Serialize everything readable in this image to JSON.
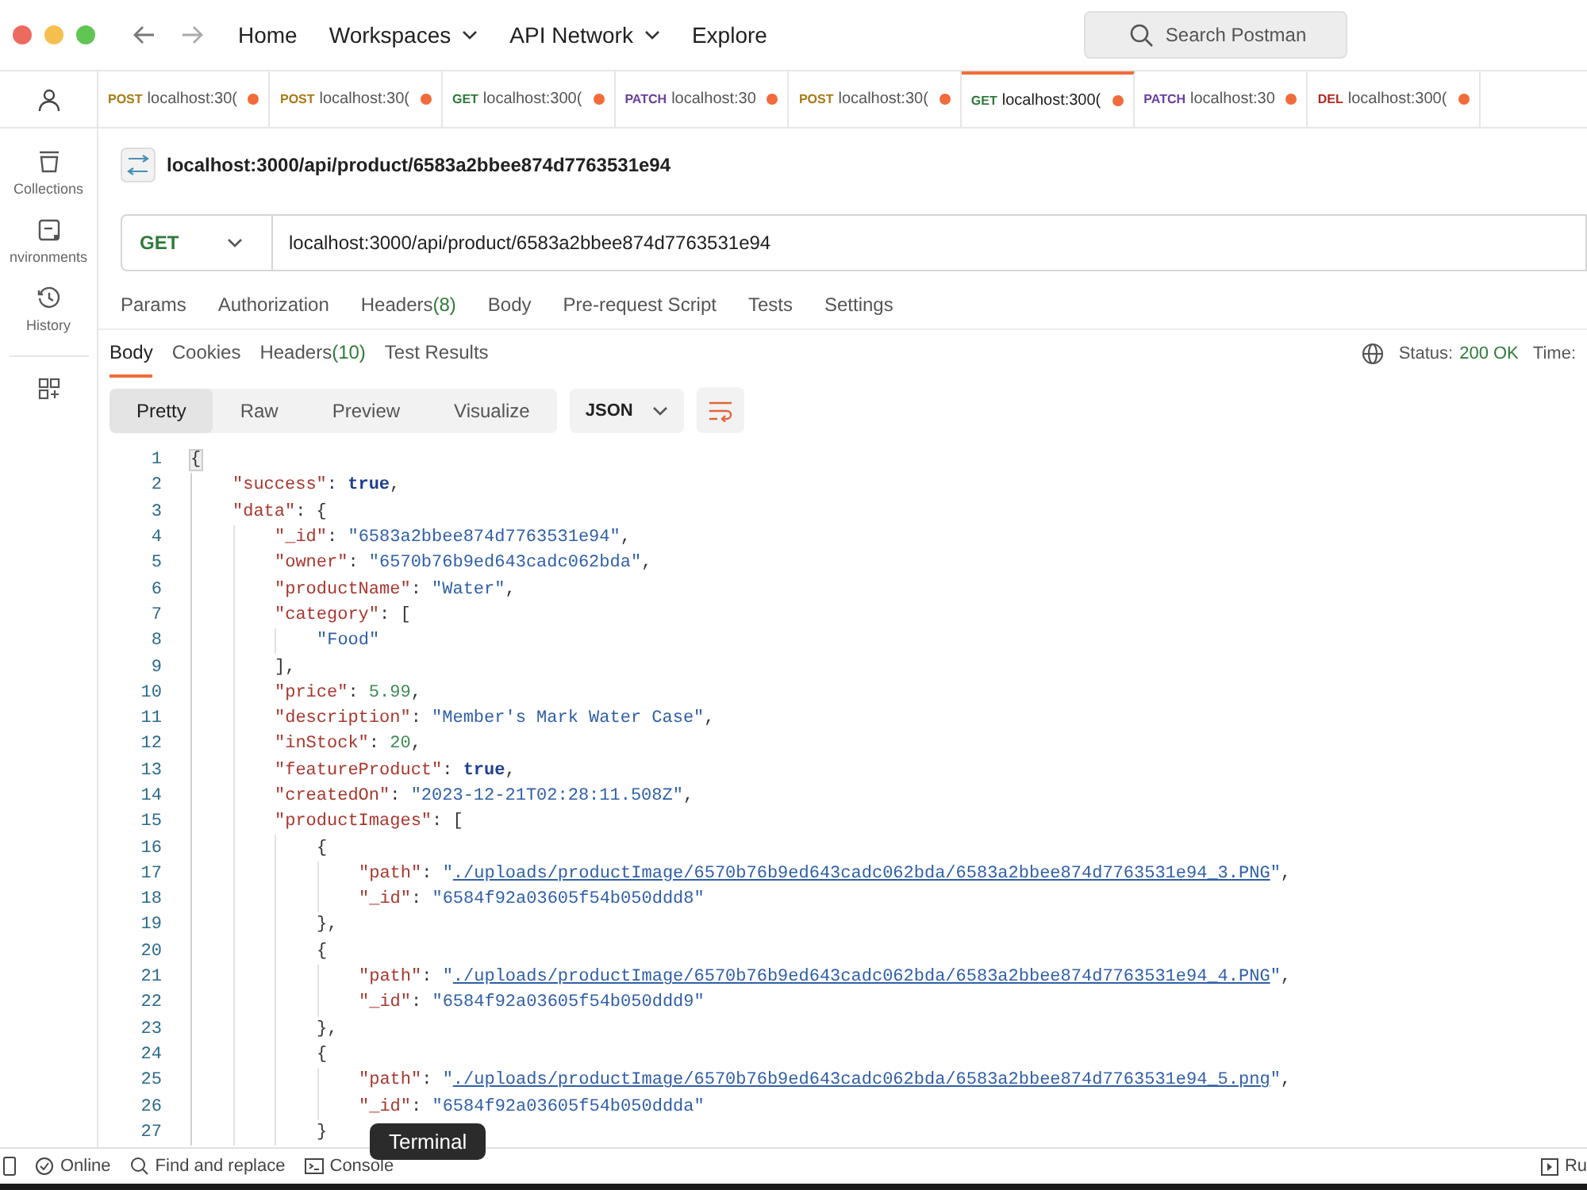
{
  "topbar": {
    "nav": [
      {
        "label": "Home",
        "dropdown": false
      },
      {
        "label": "Workspaces",
        "dropdown": true
      },
      {
        "label": "API Network",
        "dropdown": true
      },
      {
        "label": "Explore",
        "dropdown": false
      }
    ],
    "search": {
      "placeholder": "Search Postman"
    }
  },
  "sidebar": {
    "items": [
      {
        "kind": "user"
      },
      {
        "kind": "collections",
        "label": "Collections"
      },
      {
        "kind": "environments",
        "label": "nvironments"
      },
      {
        "kind": "history",
        "label": "History"
      },
      {
        "kind": "apps"
      }
    ]
  },
  "tabs": [
    {
      "method": "POST",
      "color": "#a87b16",
      "label": "localhost:30(",
      "unsaved": true,
      "selected": false
    },
    {
      "method": "POST",
      "color": "#a87b16",
      "label": "localhost:30(",
      "unsaved": true,
      "selected": false
    },
    {
      "method": "GET",
      "color": "#2f7a3a",
      "label": "localhost:300(",
      "unsaved": true,
      "selected": false
    },
    {
      "method": "PATCH",
      "color": "#6b3fa0",
      "label": "localhost:30",
      "unsaved": true,
      "selected": false
    },
    {
      "method": "POST",
      "color": "#a87b16",
      "label": "localhost:30(",
      "unsaved": true,
      "selected": false
    },
    {
      "method": "GET",
      "color": "#2f7a3a",
      "label": "localhost:300(",
      "unsaved": true,
      "selected": true
    },
    {
      "method": "PATCH",
      "color": "#6b3fa0",
      "label": "localhost:30",
      "unsaved": true,
      "selected": false
    },
    {
      "method": "DEL",
      "color": "#b3261e",
      "label": "localhost:300(",
      "unsaved": true,
      "selected": false
    }
  ],
  "request": {
    "title": "localhost:3000/api/product/6583a2bbee874d7763531e94",
    "method": "GET",
    "url": "localhost:3000/api/product/6583a2bbee874d7763531e94",
    "tabs": [
      {
        "label": "Params"
      },
      {
        "label": "Authorization"
      },
      {
        "label": "Headers",
        "count": "(8)"
      },
      {
        "label": "Body"
      },
      {
        "label": "Pre-request Script"
      },
      {
        "label": "Tests"
      },
      {
        "label": "Settings"
      }
    ]
  },
  "response": {
    "tabs": [
      {
        "label": "Body",
        "selected": true
      },
      {
        "label": "Cookies",
        "selected": false
      },
      {
        "label": "Headers",
        "count": "(10)",
        "selected": false
      },
      {
        "label": "Test Results",
        "selected": false
      }
    ],
    "status_label": "Status:",
    "status": "200 OK",
    "time_label": "Time:",
    "formats": [
      {
        "label": "Pretty",
        "selected": true
      },
      {
        "label": "Raw",
        "selected": false
      },
      {
        "label": "Preview",
        "selected": false
      },
      {
        "label": "Visualize",
        "selected": false
      }
    ],
    "language": "JSON",
    "lines": [
      {
        "n": "1",
        "tokens": [
          {
            "kind": "punct",
            "text": "{"
          }
        ]
      },
      {
        "n": "2",
        "tokens": [
          {
            "kind": "key",
            "text": "\"success\""
          },
          {
            "kind": "punct",
            "text": ": "
          },
          {
            "kind": "bool",
            "text": "true"
          },
          {
            "kind": "punct",
            "text": ","
          }
        ]
      },
      {
        "n": "3",
        "tokens": [
          {
            "kind": "key",
            "text": "\"data\""
          },
          {
            "kind": "punct",
            "text": ": {"
          }
        ]
      },
      {
        "n": "4",
        "tokens": [
          {
            "kind": "key",
            "text": "\"_id\""
          },
          {
            "kind": "punct",
            "text": ": "
          },
          {
            "kind": "str",
            "text": "\"6583a2bbee874d7763531e94\""
          },
          {
            "kind": "punct",
            "text": ","
          }
        ]
      },
      {
        "n": "5",
        "tokens": [
          {
            "kind": "key",
            "text": "\"owner\""
          },
          {
            "kind": "punct",
            "text": ": "
          },
          {
            "kind": "str",
            "text": "\"6570b76b9ed643cadc062bda\""
          },
          {
            "kind": "punct",
            "text": ","
          }
        ]
      },
      {
        "n": "6",
        "tokens": [
          {
            "kind": "key",
            "text": "\"productName\""
          },
          {
            "kind": "punct",
            "text": ": "
          },
          {
            "kind": "str",
            "text": "\"Water\""
          },
          {
            "kind": "punct",
            "text": ","
          }
        ]
      },
      {
        "n": "7",
        "tokens": [
          {
            "kind": "key",
            "text": "\"category\""
          },
          {
            "kind": "punct",
            "text": ": ["
          }
        ]
      },
      {
        "n": "8",
        "tokens": [
          {
            "kind": "str",
            "text": "\"Food\""
          }
        ]
      },
      {
        "n": "9",
        "tokens": [
          {
            "kind": "punct",
            "text": "],"
          }
        ]
      },
      {
        "n": "10",
        "tokens": [
          {
            "kind": "key",
            "text": "\"price\""
          },
          {
            "kind": "punct",
            "text": ": "
          },
          {
            "kind": "num",
            "text": "5.99"
          },
          {
            "kind": "punct",
            "text": ","
          }
        ]
      },
      {
        "n": "11",
        "tokens": [
          {
            "kind": "key",
            "text": "\"description\""
          },
          {
            "kind": "punct",
            "text": ": "
          },
          {
            "kind": "str",
            "text": "\"Member's Mark Water Case\""
          },
          {
            "kind": "punct",
            "text": ","
          }
        ]
      },
      {
        "n": "12",
        "tokens": [
          {
            "kind": "key",
            "text": "\"inStock\""
          },
          {
            "kind": "punct",
            "text": ": "
          },
          {
            "kind": "num",
            "text": "20"
          },
          {
            "kind": "punct",
            "text": ","
          }
        ]
      },
      {
        "n": "13",
        "tokens": [
          {
            "kind": "key",
            "text": "\"featureProduct\""
          },
          {
            "kind": "punct",
            "text": ": "
          },
          {
            "kind": "bool",
            "text": "true"
          },
          {
            "kind": "punct",
            "text": ","
          }
        ]
      },
      {
        "n": "14",
        "tokens": [
          {
            "kind": "key",
            "text": "\"createdOn\""
          },
          {
            "kind": "punct",
            "text": ": "
          },
          {
            "kind": "str",
            "text": "\"2023-12-21T02:28:11.508Z\""
          },
          {
            "kind": "punct",
            "text": ","
          }
        ]
      },
      {
        "n": "15",
        "tokens": [
          {
            "kind": "key",
            "text": "\"productImages\""
          },
          {
            "kind": "punct",
            "text": ": ["
          }
        ]
      },
      {
        "n": "16",
        "tokens": [
          {
            "kind": "punct",
            "text": "{"
          }
        ]
      },
      {
        "n": "17",
        "tokens": [
          {
            "kind": "key",
            "text": "\"path\""
          },
          {
            "kind": "punct",
            "text": ": "
          },
          {
            "kind": "str",
            "text": "\""
          },
          {
            "kind": "link",
            "text": "./uploads/productImage/6570b76b9ed643cadc062bda/6583a2bbee874d7763531e94_3.PNG"
          },
          {
            "kind": "str",
            "text": "\""
          },
          {
            "kind": "punct",
            "text": ","
          }
        ]
      },
      {
        "n": "18",
        "tokens": [
          {
            "kind": "key",
            "text": "\"_id\""
          },
          {
            "kind": "punct",
            "text": ": "
          },
          {
            "kind": "str",
            "text": "\"6584f92a03605f54b050ddd8\""
          }
        ]
      },
      {
        "n": "19",
        "tokens": [
          {
            "kind": "punct",
            "text": "},"
          }
        ]
      },
      {
        "n": "20",
        "tokens": [
          {
            "kind": "punct",
            "text": "{"
          }
        ]
      },
      {
        "n": "21",
        "tokens": [
          {
            "kind": "key",
            "text": "\"path\""
          },
          {
            "kind": "punct",
            "text": ": "
          },
          {
            "kind": "str",
            "text": "\""
          },
          {
            "kind": "link",
            "text": "./uploads/productImage/6570b76b9ed643cadc062bda/6583a2bbee874d7763531e94_4.PNG"
          },
          {
            "kind": "str",
            "text": "\""
          },
          {
            "kind": "punct",
            "text": ","
          }
        ]
      },
      {
        "n": "22",
        "tokens": [
          {
            "kind": "key",
            "text": "\"_id\""
          },
          {
            "kind": "punct",
            "text": ": "
          },
          {
            "kind": "str",
            "text": "\"6584f92a03605f54b050ddd9\""
          }
        ]
      },
      {
        "n": "23",
        "tokens": [
          {
            "kind": "punct",
            "text": "},"
          }
        ]
      },
      {
        "n": "24",
        "tokens": [
          {
            "kind": "punct",
            "text": "{"
          }
        ]
      },
      {
        "n": "25",
        "tokens": [
          {
            "kind": "key",
            "text": "\"path\""
          },
          {
            "kind": "punct",
            "text": ": "
          },
          {
            "kind": "str",
            "text": "\""
          },
          {
            "kind": "link",
            "text": "./uploads/productImage/6570b76b9ed643cadc062bda/6583a2bbee874d7763531e94_5.png"
          },
          {
            "kind": "str",
            "text": "\""
          },
          {
            "kind": "punct",
            "text": ","
          }
        ]
      },
      {
        "n": "26",
        "tokens": [
          {
            "kind": "key",
            "text": "\"_id\""
          },
          {
            "kind": "punct",
            "text": ": "
          },
          {
            "kind": "str",
            "text": "\"6584f92a03605f54b050ddda\""
          }
        ]
      },
      {
        "n": "27",
        "tokens": [
          {
            "kind": "punct",
            "text": "}"
          }
        ]
      }
    ]
  },
  "status_bar": {
    "items": [
      {
        "kind": "online",
        "label": "Online"
      },
      {
        "kind": "find",
        "label": "Find and replace"
      },
      {
        "kind": "console",
        "label": "Console"
      }
    ],
    "tooltip": "Terminal",
    "right": "Ru"
  }
}
